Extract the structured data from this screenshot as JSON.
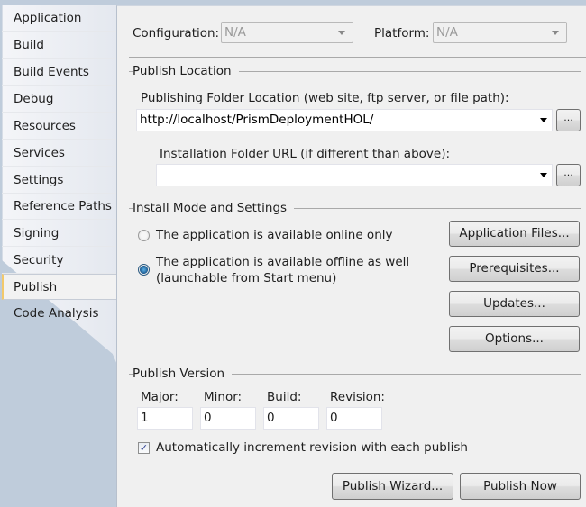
{
  "sidebar": {
    "tabs": [
      {
        "label": "Application"
      },
      {
        "label": "Build"
      },
      {
        "label": "Build Events"
      },
      {
        "label": "Debug"
      },
      {
        "label": "Resources"
      },
      {
        "label": "Services"
      },
      {
        "label": "Settings"
      },
      {
        "label": "Reference Paths"
      },
      {
        "label": "Signing"
      },
      {
        "label": "Security"
      },
      {
        "label": "Publish",
        "active": true
      },
      {
        "label": "Code Analysis"
      }
    ]
  },
  "header": {
    "configuration_label": "Configuration:",
    "configuration_value": "N/A",
    "platform_label": "Platform:",
    "platform_value": "N/A"
  },
  "publish_location": {
    "title": "Publish Location",
    "folder_label": "Publishing Folder Location (web site, ftp server, or file path):",
    "folder_value": "http://localhost/PrismDeploymentHOL/",
    "install_url_label": "Installation Folder URL (if different than above):",
    "install_url_value": "",
    "browse_label": "..."
  },
  "install_mode": {
    "title": "Install Mode and Settings",
    "option_online": "The application is available online only",
    "option_offline_line1": "The application is available offline as well",
    "option_offline_line2": "(launchable from Start menu)",
    "selected": "offline",
    "buttons": {
      "application_files": "Application Files...",
      "prerequisites": "Prerequisites...",
      "updates": "Updates...",
      "options": "Options..."
    }
  },
  "publish_version": {
    "title": "Publish Version",
    "major_label": "Major:",
    "minor_label": "Minor:",
    "build_label": "Build:",
    "revision_label": "Revision:",
    "major": "1",
    "minor": "0",
    "build": "0",
    "revision": "0",
    "auto_increment_label": "Automatically increment revision with each publish",
    "auto_increment_checked": true,
    "checkmark": "✓"
  },
  "footer": {
    "publish_wizard": "Publish Wizard...",
    "publish_now": "Publish Now"
  }
}
